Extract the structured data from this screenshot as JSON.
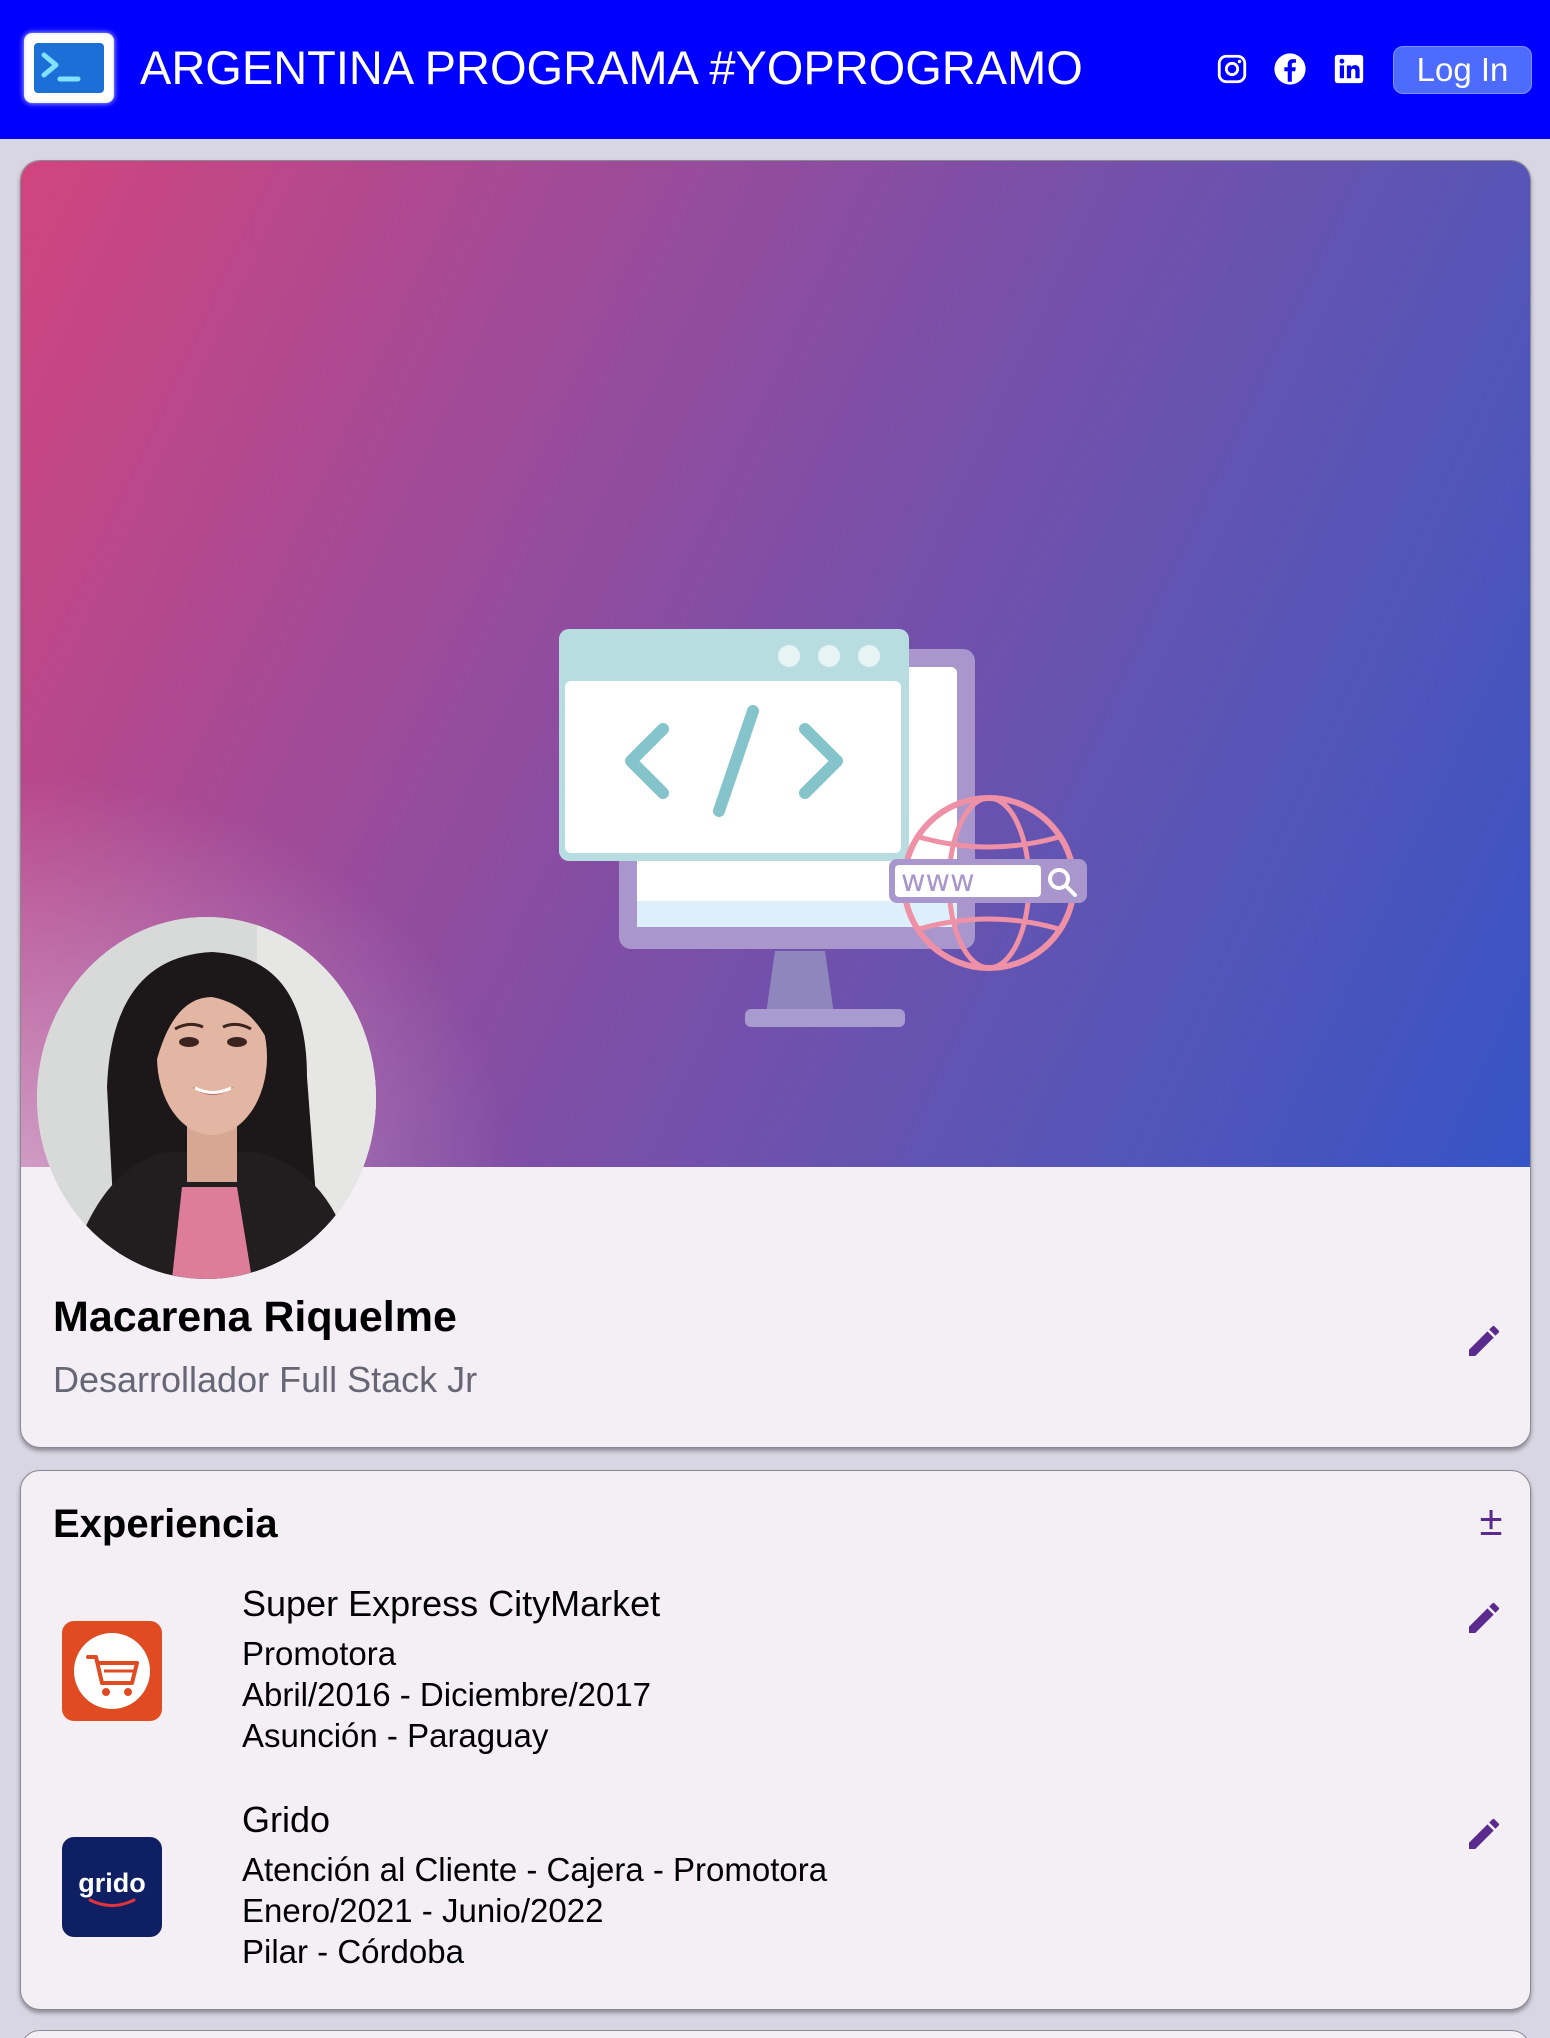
{
  "header": {
    "brand": "ARGENTINA PROGRAMA #YOPROGRAMO",
    "login_label": "Log In",
    "social_icons": [
      "instagram-icon",
      "facebook-icon",
      "linkedin-icon"
    ]
  },
  "banner": {
    "illustration_text": "www"
  },
  "profile": {
    "name": "Macarena Riquelme",
    "role": "Desarrollador Full Stack Jr"
  },
  "experience": {
    "title": "Experiencia",
    "add_label": "±",
    "items": [
      {
        "company": "Super Express CityMarket",
        "position": "Promotora",
        "period": "Abril/2016 - Diciembre/2017",
        "location": "Asunción - Paraguay"
      },
      {
        "company": "Grido",
        "logo_text": "grido",
        "position": "Atención al Cliente - Cajera - Promotora",
        "period": "Enero/2021 - Junio/2022",
        "location": "Pilar - Córdoba"
      }
    ]
  },
  "colors": {
    "header_bg": "#0000ff",
    "accent": "#5b2a8f",
    "page_bg": "#d9d6e3",
    "card_bg": "#f3eff5"
  }
}
